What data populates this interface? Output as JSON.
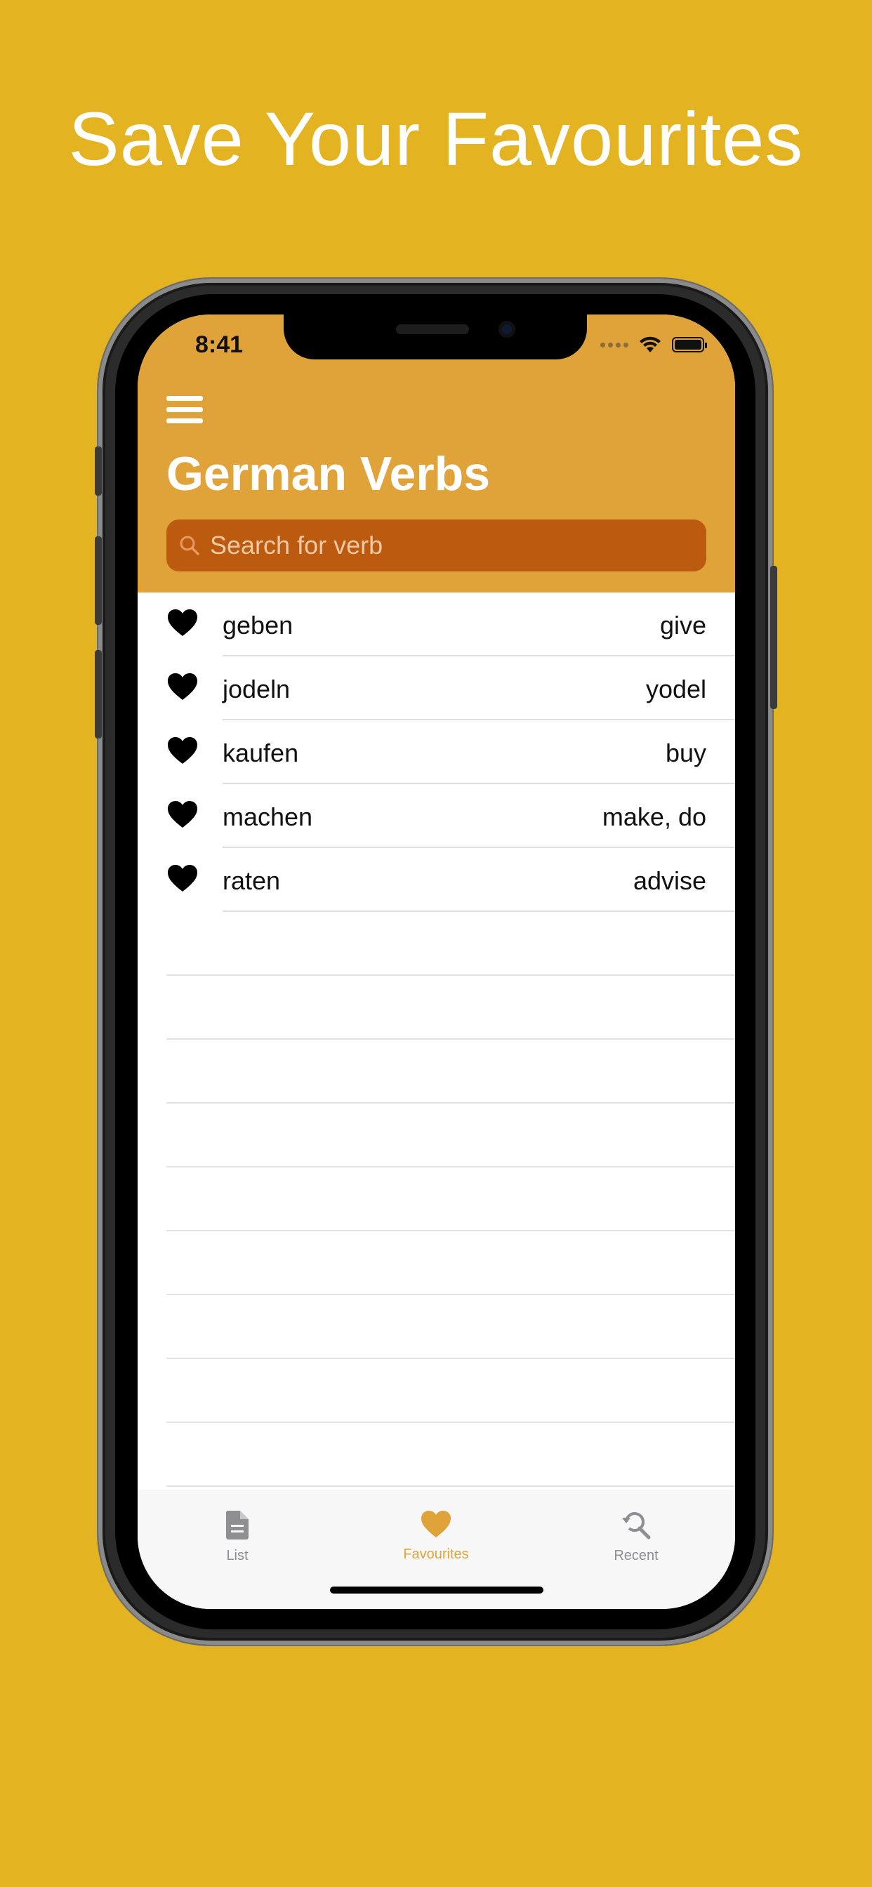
{
  "headline": "Save Your Favourites",
  "status_bar": {
    "time": "8:41"
  },
  "app": {
    "title": "German Verbs",
    "search": {
      "placeholder": "Search for verb",
      "value": ""
    }
  },
  "favourites": [
    {
      "verb": "geben",
      "translation": "give"
    },
    {
      "verb": "jodeln",
      "translation": "yodel"
    },
    {
      "verb": "kaufen",
      "translation": "buy"
    },
    {
      "verb": "machen",
      "translation": "make, do"
    },
    {
      "verb": "raten",
      "translation": "advise"
    }
  ],
  "tabs": [
    {
      "label": "List",
      "icon": "document-icon",
      "active": false
    },
    {
      "label": "Favourites",
      "icon": "heart-icon",
      "active": true
    },
    {
      "label": "Recent",
      "icon": "history-search-icon",
      "active": false
    }
  ],
  "colors": {
    "background": "#e4b322",
    "nav_bar": "#e0a33a",
    "search_field": "#bc5a0f",
    "accent": "#e0a33a"
  }
}
